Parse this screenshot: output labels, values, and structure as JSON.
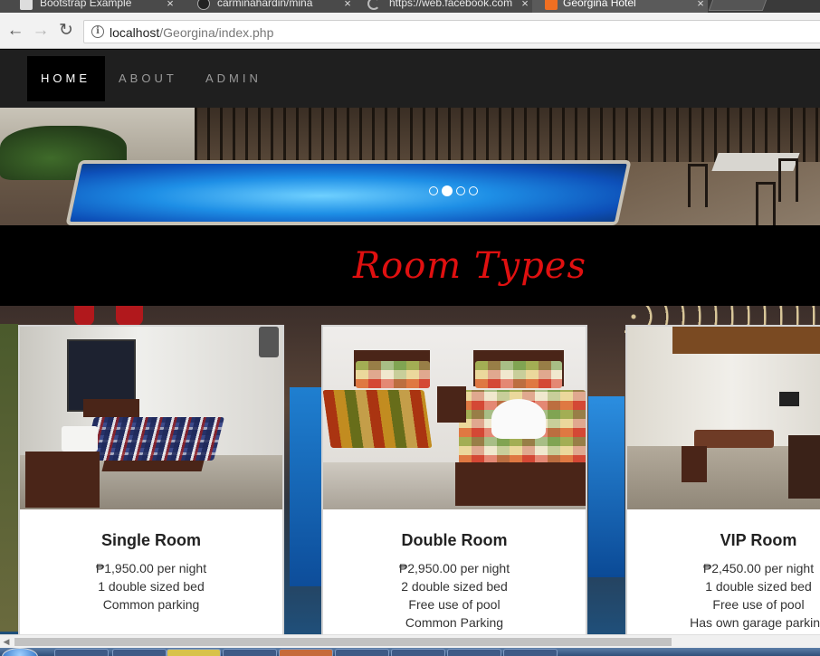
{
  "browser": {
    "tabs": [
      {
        "title": "Bootstrap Example",
        "icon": "document-icon",
        "active": false
      },
      {
        "title": "carminahardin/mina",
        "icon": "github-icon",
        "active": false
      },
      {
        "title": "https://web.facebook.com",
        "icon": "loading-icon",
        "active": false
      },
      {
        "title": "Georgina Hotel",
        "icon": "xampp-icon",
        "active": true
      }
    ],
    "close_glyph": "×",
    "address": {
      "host": "localhost",
      "path": "/Georgina/index.php"
    }
  },
  "site": {
    "nav": [
      {
        "label": "HOME",
        "active": true
      },
      {
        "label": "ABOUT",
        "active": false
      },
      {
        "label": "ADMIN",
        "active": false
      }
    ],
    "carousel": {
      "slide_count": 4,
      "active_index": 1
    },
    "section_title": "Room Types",
    "rooms": [
      {
        "name": "Single Room",
        "price": "₱1,950.00 per night",
        "features": [
          "1 double sized bed",
          "Common parking"
        ]
      },
      {
        "name": "Double Room",
        "price": "₱2,950.00 per night",
        "features": [
          "2 double sized bed",
          "Free use of pool",
          "Common Parking"
        ]
      },
      {
        "name": "VIP Room",
        "price": "₱2,450.00 per night",
        "features": [
          "1 double sized bed",
          "Free use of pool",
          "Has own garage parking"
        ]
      }
    ]
  },
  "colors": {
    "title_red": "#e01010",
    "nav_bg": "#1f1f1f",
    "nav_active_bg": "#000000"
  }
}
